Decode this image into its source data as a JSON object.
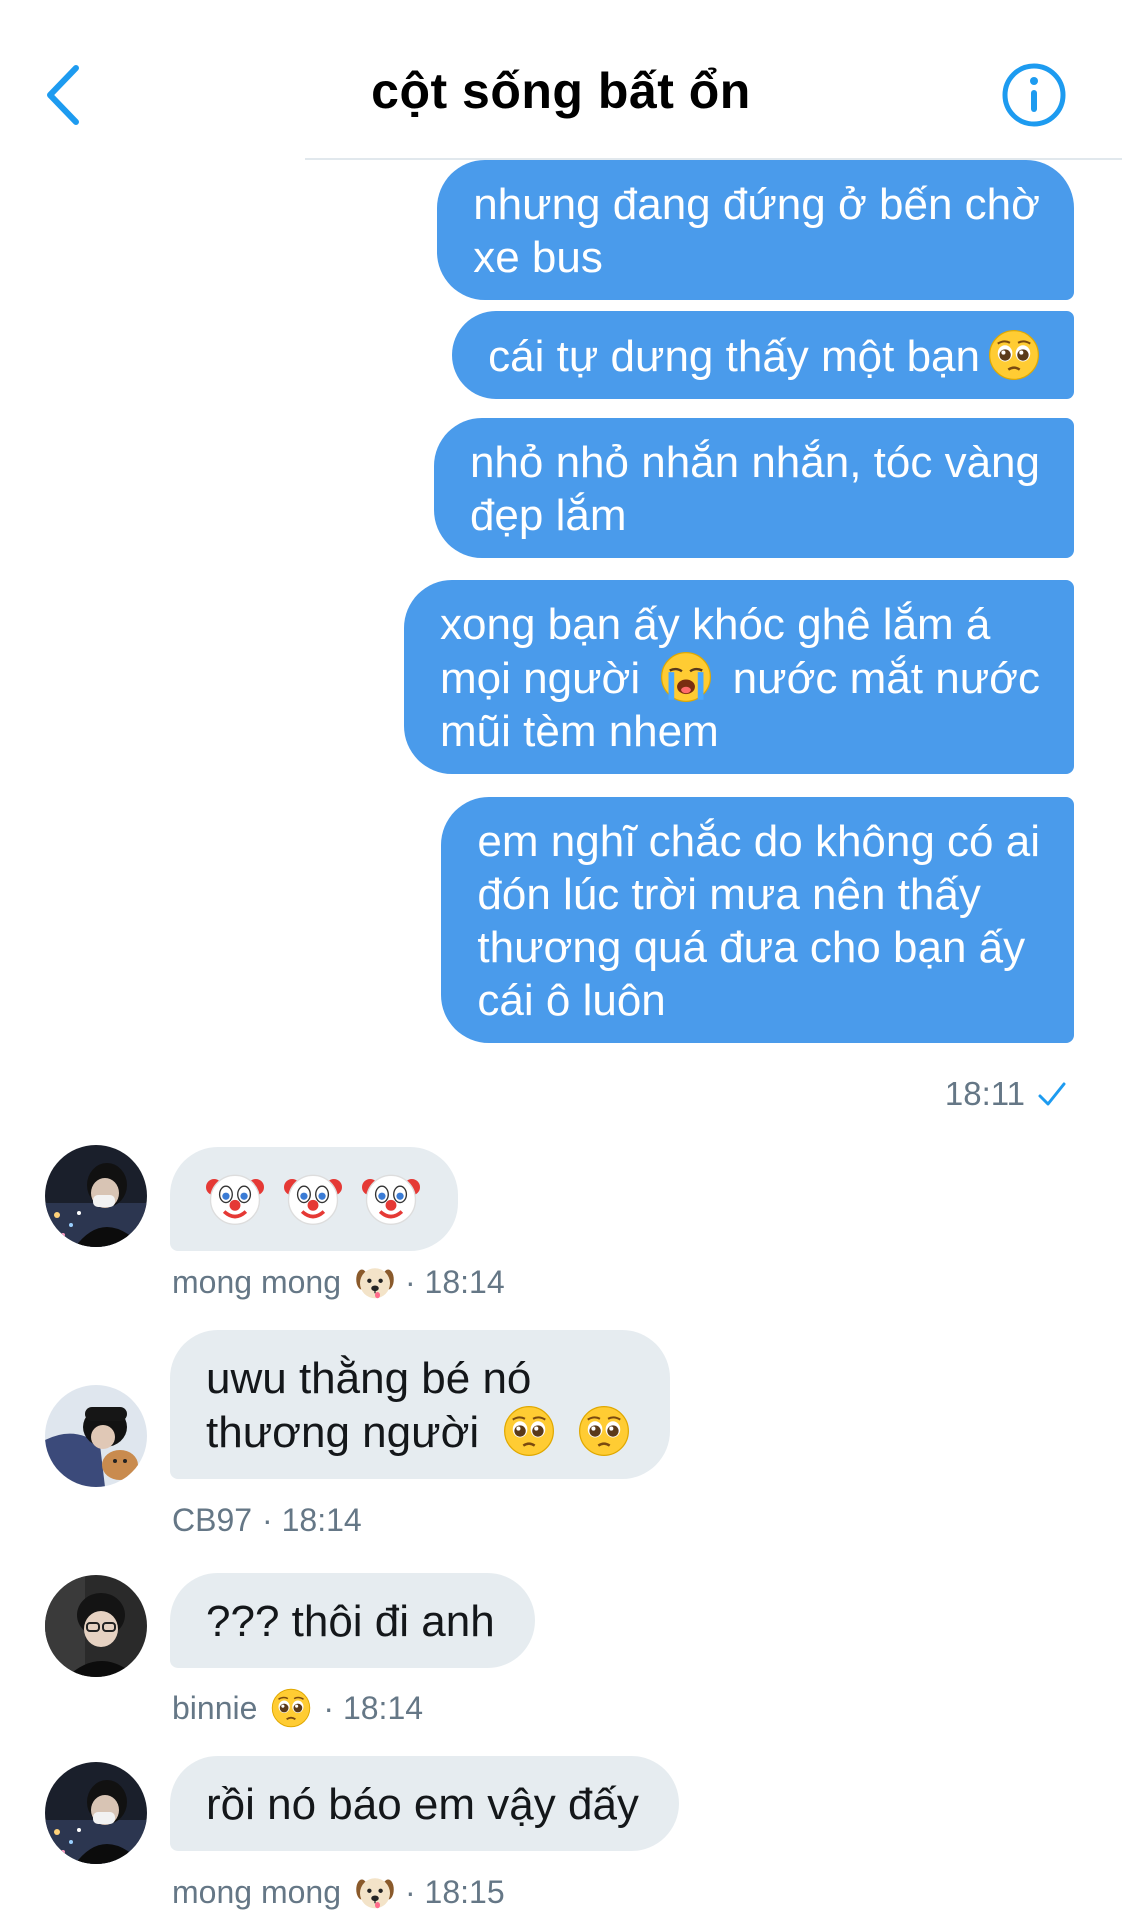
{
  "header": {
    "title": "cột sống bất ổn",
    "back_icon": "chevron-left-icon",
    "info_icon": "info-icon",
    "accent_color": "#1d9bf0"
  },
  "outgoing": {
    "bubble_color": "#4a9beb",
    "messages": [
      {
        "line1": "nhưng đang đứng ở bến chờ",
        "line2": "xe bus"
      },
      {
        "text": "cái tự dưng thấy một bạn",
        "emoji": "pleading-face-emoji"
      },
      {
        "line1": "nhỏ nhỏ nhắn nhắn, tóc vàng",
        "line2": "đẹp lắm"
      },
      {
        "line1": "xong bạn ấy khóc ghê lắm á",
        "line2a": "mọi người",
        "emoji": "loudly-crying-face-emoji",
        "line2b": "nước mắt nước",
        "line3": "mũi tèm nhem"
      },
      {
        "line1": "em nghĩ chắc do không có ai",
        "line2": "đón lúc trời mưa nên thấy",
        "line3": "thương quá đưa cho bạn ấy",
        "line4": "cái ô luôn"
      }
    ],
    "time": "18:11",
    "status_icon": "checkmark-icon"
  },
  "incoming": [
    {
      "sender": "mong mong",
      "sender_emoji": "dog-face-emoji",
      "time": "· 18:14",
      "emojis": [
        "clown-face-emoji",
        "clown-face-emoji",
        "clown-face-emoji"
      ]
    },
    {
      "sender": "CB97",
      "time": "· 18:14",
      "line1": "uwu thằng bé nó",
      "line2": "thương người",
      "emojis": [
        "pleading-face-emoji",
        "pleading-face-emoji"
      ]
    },
    {
      "sender": "binnie",
      "sender_emoji": "pleading-face-emoji",
      "time": "· 18:14",
      "text": "??? thôi đi anh"
    },
    {
      "sender": "mong mong",
      "sender_emoji": "dog-face-emoji",
      "time": "· 18:15",
      "text": "rồi nó báo em vậy đấy"
    }
  ]
}
